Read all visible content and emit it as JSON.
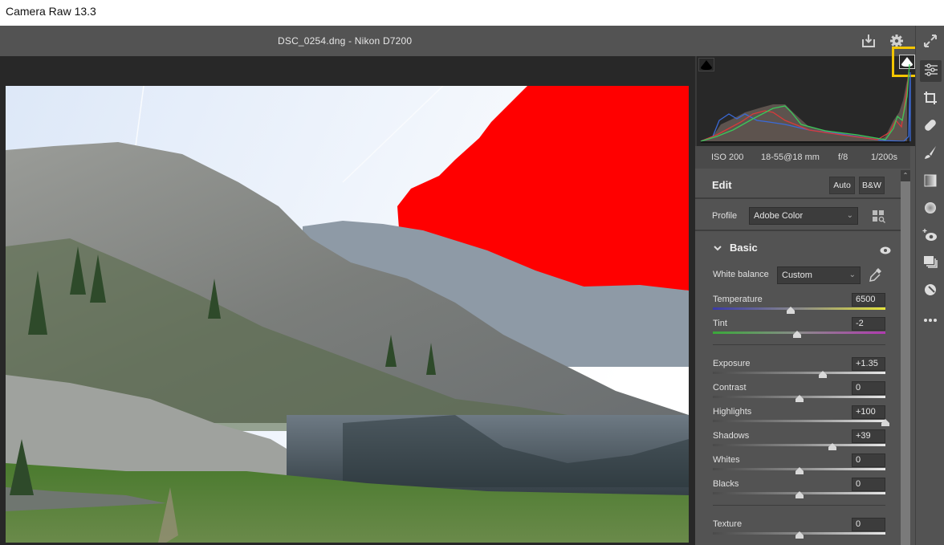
{
  "window": {
    "title": "Camera Raw 13.3"
  },
  "header": {
    "filename": "DSC_0254.dng  -  Nikon D7200",
    "icons": [
      "save-icon",
      "settings-gear-icon",
      "fullscreen-toggle-icon"
    ]
  },
  "histogram": {
    "shadow_clipping_label": "shadow-clipping-warning",
    "highlight_clipping_label": "highlight-clipping-warning",
    "highlight_clipping_active": true
  },
  "exif": {
    "iso": "ISO 200",
    "lens": "18-55@18 mm",
    "aperture": "f/8",
    "shutter": "1/200s"
  },
  "edit": {
    "title": "Edit",
    "auto_label": "Auto",
    "bw_label": "B&W",
    "profile_label": "Profile",
    "profile_value": "Adobe Color"
  },
  "basic": {
    "title": "Basic",
    "white_balance_label": "White balance",
    "white_balance_value": "Custom",
    "sliders": [
      {
        "label": "Temperature",
        "value": "6500",
        "position": 0.45,
        "track": "temp"
      },
      {
        "label": "Tint",
        "value": "-2",
        "position": 0.49,
        "track": "tint"
      },
      {
        "label": "Exposure",
        "value": "+1.35",
        "position": 0.635,
        "track": "gray"
      },
      {
        "label": "Contrast",
        "value": "0",
        "position": 0.5,
        "track": "gray"
      },
      {
        "label": "Highlights",
        "value": "+100",
        "position": 1.0,
        "track": "gray"
      },
      {
        "label": "Shadows",
        "value": "+39",
        "position": 0.695,
        "track": "gray"
      },
      {
        "label": "Whites",
        "value": "0",
        "position": 0.5,
        "track": "gray"
      },
      {
        "label": "Blacks",
        "value": "0",
        "position": 0.5,
        "track": "gray"
      },
      {
        "label": "Texture",
        "value": "0",
        "position": 0.5,
        "track": "gray"
      }
    ]
  },
  "toolstrip": [
    {
      "name": "edit-sliders-icon",
      "active": true
    },
    {
      "name": "crop-icon",
      "active": false
    },
    {
      "name": "healing-bandage-icon",
      "active": false
    },
    {
      "name": "brush-icon",
      "active": false
    },
    {
      "name": "gradient-icon",
      "active": false
    },
    {
      "name": "radial-filter-icon",
      "active": false
    },
    {
      "name": "red-eye-icon",
      "active": false
    },
    {
      "name": "snapshots-icon",
      "active": false
    },
    {
      "name": "presets-icon",
      "active": false
    },
    {
      "name": "more-options-icon",
      "active": false
    }
  ],
  "colors": {
    "clipping_warning": "#ff0000",
    "highlight_frame": "#f2c500",
    "panel_bg": "#535353",
    "canvas_bg": "#282828"
  }
}
